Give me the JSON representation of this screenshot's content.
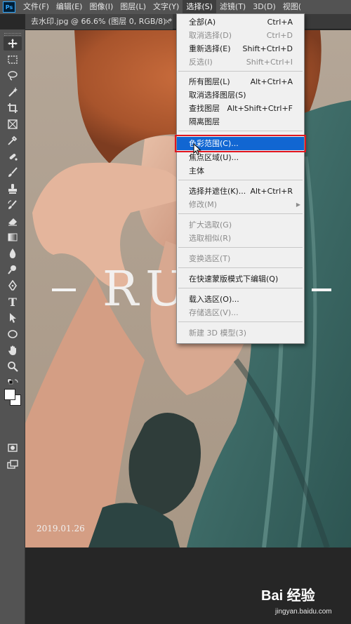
{
  "menubar": {
    "logo": "Ps",
    "items": [
      "文件(F)",
      "编辑(E)",
      "图像(I)",
      "图层(L)",
      "文字(Y)",
      "选择(S)",
      "滤镜(T)",
      "3D(D)",
      "视图("
    ]
  },
  "document": {
    "tab_title": "去水印.jpg @ 66.6% (图层 0, RGB/8) *",
    "tab_close": "×"
  },
  "canvas": {
    "watermark_text": "RU",
    "date": "2019.01.26"
  },
  "select_menu": {
    "items": [
      {
        "label": "全部(A)",
        "shortcut": "Ctrl+A",
        "enabled": true
      },
      {
        "label": "取消选择(D)",
        "shortcut": "Ctrl+D",
        "enabled": false
      },
      {
        "label": "重新选择(E)",
        "shortcut": "Shift+Ctrl+D",
        "enabled": true
      },
      {
        "label": "反选(I)",
        "shortcut": "Shift+Ctrl+I",
        "enabled": false
      },
      {
        "label": "所有图层(L)",
        "shortcut": "Alt+Ctrl+A",
        "enabled": true
      },
      {
        "label": "取消选择图层(S)",
        "shortcut": "",
        "enabled": true
      },
      {
        "label": "查找图层",
        "shortcut": "Alt+Shift+Ctrl+F",
        "enabled": true
      },
      {
        "label": "隔离图层",
        "shortcut": "",
        "enabled": true
      },
      {
        "label": "色彩范围(C)...",
        "shortcut": "",
        "enabled": true,
        "highlighted": true
      },
      {
        "label": "焦点区域(U)...",
        "shortcut": "",
        "enabled": true
      },
      {
        "label": "主体",
        "shortcut": "",
        "enabled": true
      },
      {
        "label": "选择并遮住(K)...",
        "shortcut": "Alt+Ctrl+R",
        "enabled": true
      },
      {
        "label": "修改(M)",
        "shortcut": "",
        "enabled": false,
        "submenu": true
      },
      {
        "label": "扩大选取(G)",
        "shortcut": "",
        "enabled": false
      },
      {
        "label": "选取相似(R)",
        "shortcut": "",
        "enabled": false
      },
      {
        "label": "变换选区(T)",
        "shortcut": "",
        "enabled": false
      },
      {
        "label": "在快速蒙版模式下编辑(Q)",
        "shortcut": "",
        "enabled": true
      },
      {
        "label": "载入选区(O)...",
        "shortcut": "",
        "enabled": true
      },
      {
        "label": "存储选区(V)...",
        "shortcut": "",
        "enabled": false
      },
      {
        "label": "新建 3D 模型(3)",
        "shortcut": "",
        "enabled": false
      }
    ],
    "submenu_arrow": "▶"
  },
  "tools": [
    "move-icon",
    "marquee-icon",
    "lasso-icon",
    "magic-wand-icon",
    "crop-icon",
    "frame-icon",
    "eyedropper-icon",
    "healing-brush-icon",
    "brush-icon",
    "clone-stamp-icon",
    "history-brush-icon",
    "eraser-icon",
    "gradient-icon",
    "blur-icon",
    "dodge-icon",
    "pen-icon",
    "type-icon",
    "path-selection-icon",
    "ellipse-icon",
    "hand-icon",
    "zoom-icon",
    "quick-mask-icon",
    "screen-mode-icon"
  ],
  "toolbar": {
    "type_glyph": "T"
  },
  "baidu": {
    "logo": "Bai 经验",
    "domain": "jingyan.baidu.com"
  },
  "colors": {
    "menu_highlight": "#1166d2",
    "highlight_frame": "#e0151e",
    "ps_blue": "#31a8ff"
  }
}
